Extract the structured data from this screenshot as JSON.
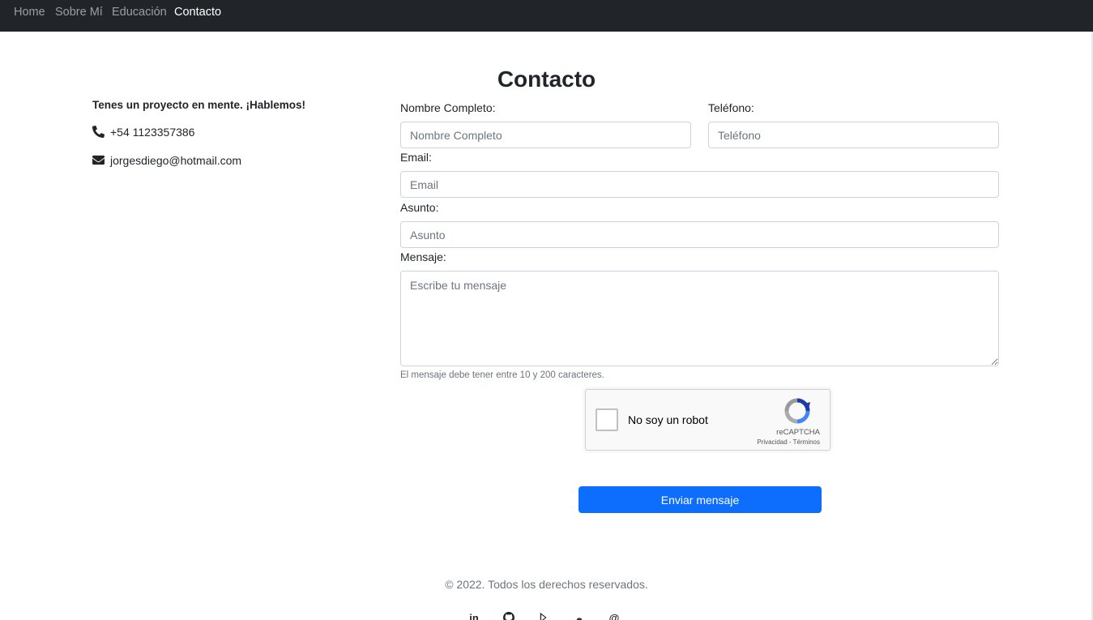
{
  "nav": {
    "items": [
      {
        "label": "Home",
        "active": false
      },
      {
        "label": "Sobre Mí",
        "active": false
      },
      {
        "label": "Educación",
        "active": false
      },
      {
        "label": "Contacto",
        "active": true
      }
    ]
  },
  "page": {
    "title": "Contacto"
  },
  "info": {
    "intro": "Tenes un proyecto en mente. ¡Hablemos!",
    "phone": "+54 1123357386",
    "email": "jorgesdiego@hotmail.com",
    "phone_icon": "phone-icon",
    "email_icon": "envelope-icon"
  },
  "form": {
    "name_label": "Nombre Completo:",
    "name_placeholder": "Nombre Completo",
    "phone_label": "Teléfono:",
    "phone_placeholder": "Teléfono",
    "email_label": "Email:",
    "email_placeholder": "Email",
    "subject_label": "Asunto:",
    "subject_placeholder": "Asunto",
    "message_label": "Mensaje:",
    "message_placeholder": "Escribe tu mensaje",
    "message_hint": "El mensaje debe tener entre 10 y 200 caracteres.",
    "submit_label": "Enviar mensaje"
  },
  "captcha": {
    "label": "No soy un robot",
    "brand": "reCAPTCHA",
    "terms": "Privacidad - Términos"
  },
  "footer": {
    "copyright": "© 2022. Todos los derechos reservados.",
    "social": [
      {
        "name": "linkedin-icon",
        "glyph": "in"
      },
      {
        "name": "github-icon"
      },
      {
        "name": "google-play-icon"
      },
      {
        "name": "podcast-icon"
      },
      {
        "name": "at-sign-icon",
        "glyph": "@"
      }
    ]
  },
  "colors": {
    "navbar": "#212529",
    "primary": "#0d6efd",
    "text": "#212529",
    "muted": "#6c757d"
  }
}
